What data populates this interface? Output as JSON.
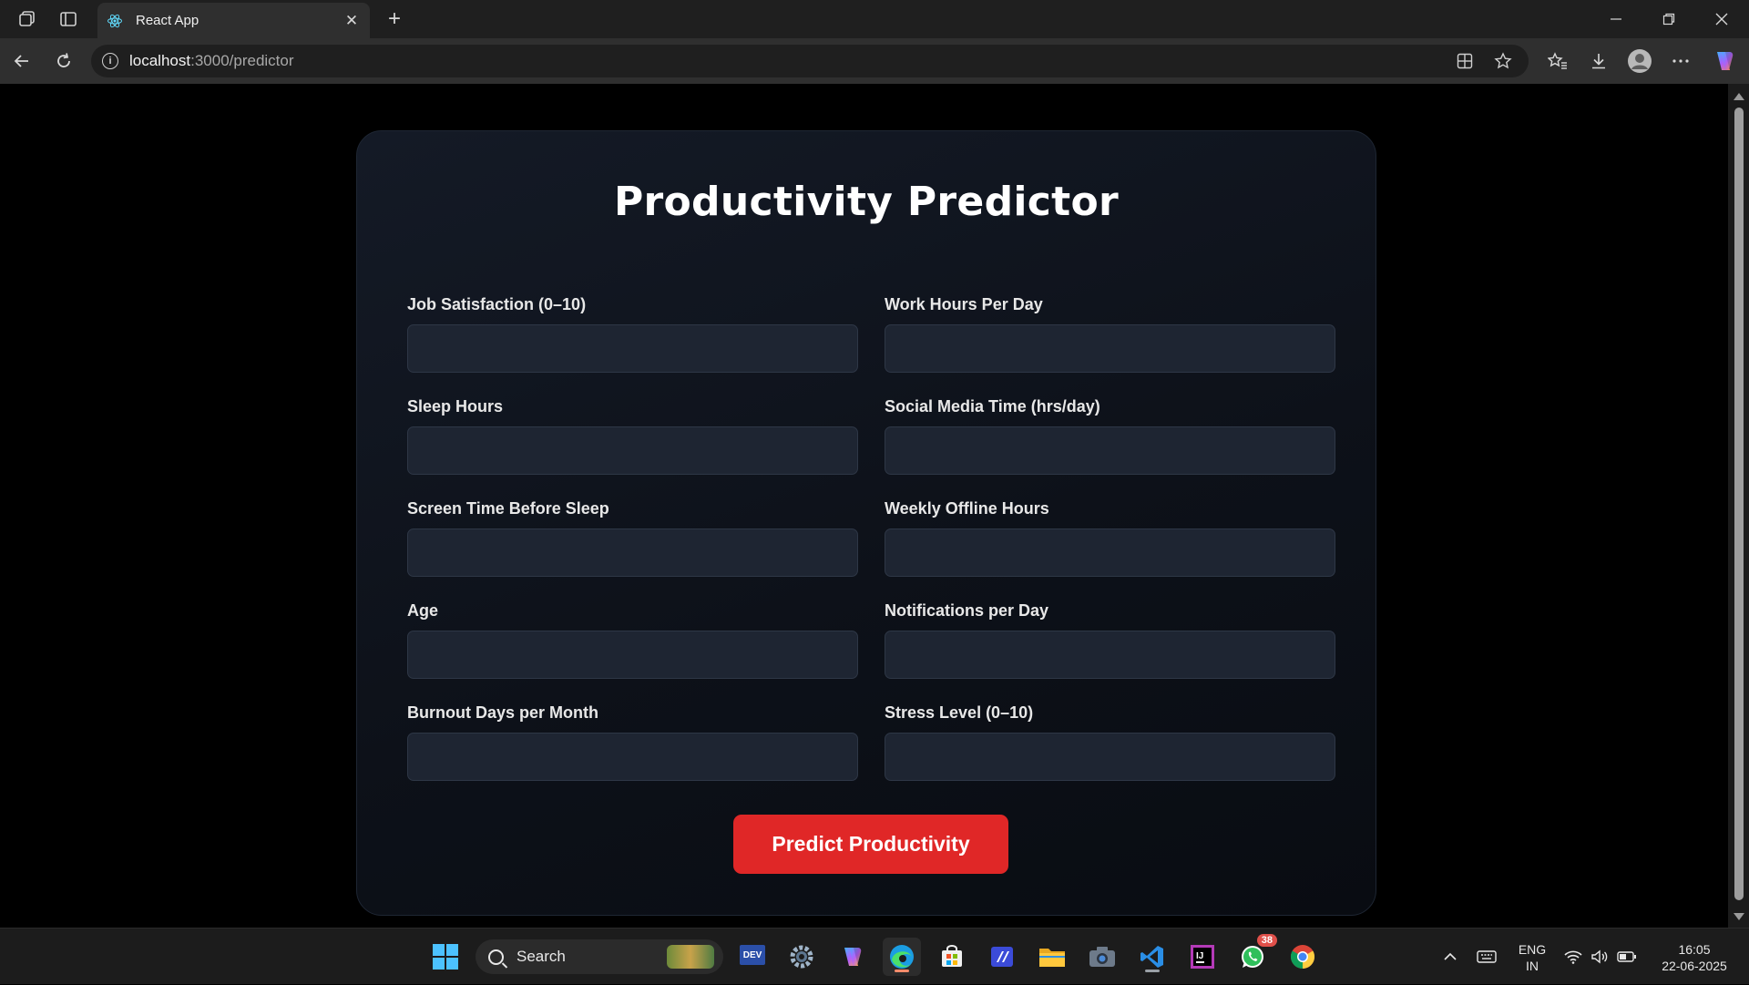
{
  "browser": {
    "tab_title": "React App",
    "url_host": "localhost",
    "url_path": ":3000/predictor",
    "new_tab_label": "+",
    "close_tab_label": "✕"
  },
  "page": {
    "title": "Productivity Predictor",
    "fields": [
      {
        "label": "Job Satisfaction (0–10)",
        "value": ""
      },
      {
        "label": "Work Hours Per Day",
        "value": ""
      },
      {
        "label": "Sleep Hours",
        "value": ""
      },
      {
        "label": "Social Media Time (hrs/day)",
        "value": ""
      },
      {
        "label": "Screen Time Before Sleep",
        "value": ""
      },
      {
        "label": "Weekly Offline Hours",
        "value": ""
      },
      {
        "label": "Age",
        "value": ""
      },
      {
        "label": "Notifications per Day",
        "value": ""
      },
      {
        "label": "Burnout Days per Month",
        "value": ""
      },
      {
        "label": "Stress Level (0–10)",
        "value": ""
      }
    ],
    "submit_label": "Predict Productivity"
  },
  "taskbar": {
    "search_label": "Search",
    "whatsapp_badge": "38",
    "language_line1": "ENG",
    "language_line2": "IN",
    "time": "16:05",
    "date": "22-06-2025"
  },
  "colors": {
    "accent_button": "#e02727",
    "card_bg": "#0d1119",
    "input_bg": "#1e2532"
  }
}
